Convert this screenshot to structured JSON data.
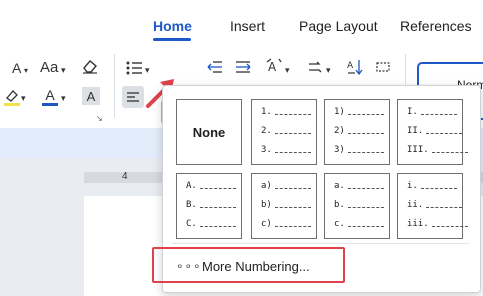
{
  "ribbon": {
    "tabs": [
      {
        "label": "Home",
        "active": true
      },
      {
        "label": "Insert",
        "active": false
      },
      {
        "label": "Page Layout",
        "active": false
      },
      {
        "label": "References",
        "active": false
      }
    ]
  },
  "toolbar": {
    "font_size_label": "A",
    "change_case_label": "Aa",
    "clear_format_icon": "eraser-icon",
    "highlight_label": "A",
    "font_color_label": "A",
    "char_shading_label": "A",
    "bullets_icon": "bullet-list-icon",
    "numbering_icon": "numbered-list-icon",
    "style_preview": "Norm"
  },
  "ruler": {
    "mark": "4"
  },
  "dropdown": {
    "none_label": "None",
    "tiles": [
      [
        "1.",
        "2.",
        "3."
      ],
      [
        "1)",
        "2)",
        "3)"
      ],
      [
        "I.",
        "II.",
        "III."
      ],
      [
        "A.",
        "B.",
        "C."
      ],
      [
        "a)",
        "b)",
        "c)"
      ],
      [
        "a.",
        "b.",
        "c."
      ],
      [
        "i.",
        "ii.",
        "iii."
      ]
    ],
    "more_dots": "∘∘∘",
    "more_label": "More Numbering..."
  },
  "colors": {
    "accent": "#1f58c7",
    "highlight_red": "#e0424c",
    "highlight_yellow": "#f1e14c",
    "font_blue": "#1f58c7"
  }
}
